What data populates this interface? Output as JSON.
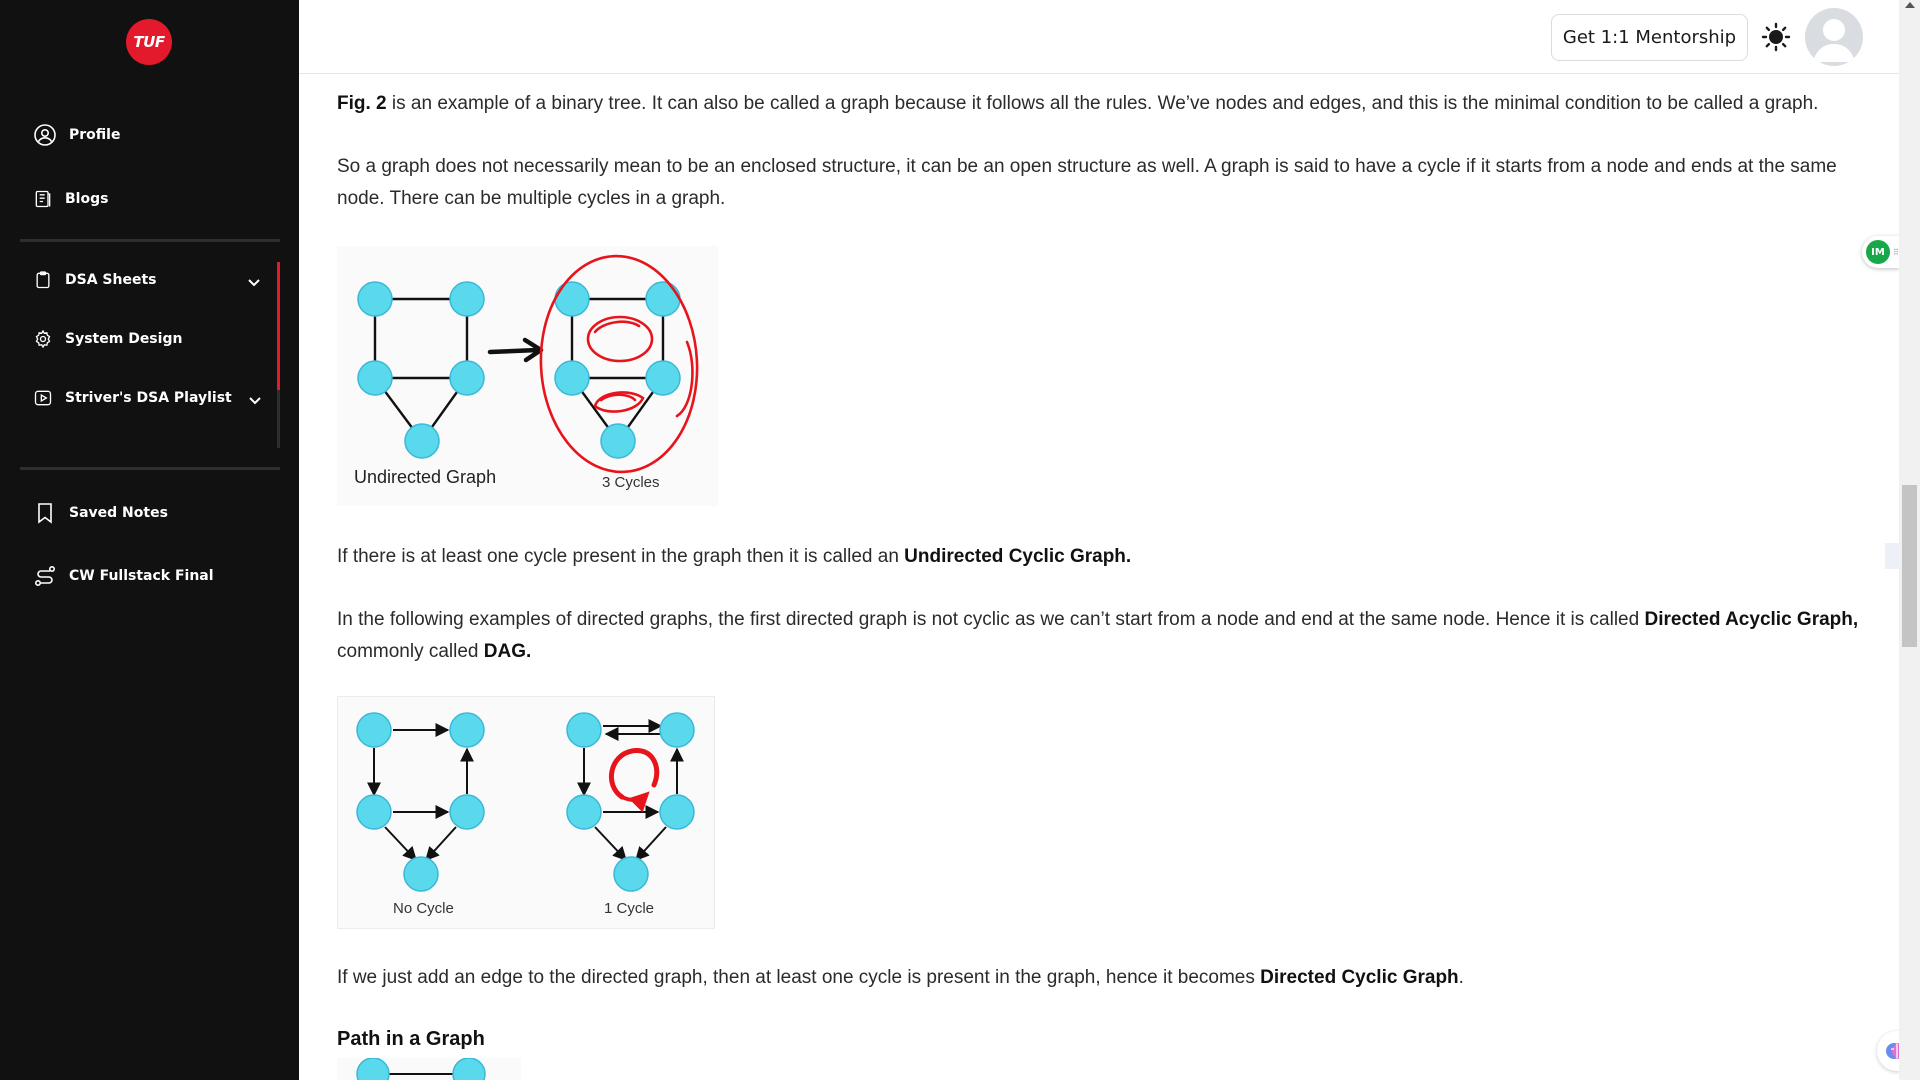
{
  "sidebar": {
    "logo_text": "TUF",
    "items": [
      {
        "label": "Profile"
      },
      {
        "label": "Blogs"
      },
      {
        "label": "DSA Sheets"
      },
      {
        "label": "System Design"
      },
      {
        "label": "Striver's DSA Playlist"
      },
      {
        "label": "Saved Notes"
      },
      {
        "label": "CW Fullstack Final"
      }
    ]
  },
  "header": {
    "mentorship_label": "Get 1:1 Mentorship"
  },
  "article": {
    "p1_bold": "Fig. 2",
    "p1_rest": " is an example of a binary tree. It can also be called a graph because it follows all the rules. We’ve nodes and edges, and this is the minimal condition to be called a graph.",
    "p2": "So a graph does not necessarily mean to be an enclosed structure, it can be an open structure as well. A graph is said to have a cycle if it starts from a node and ends at the same node. There can be multiple cycles in a graph.",
    "fig1_caption_left": "Undirected Graph",
    "fig1_caption_right": "3 Cycles",
    "p3_text": "If there is at least one cycle present in the graph then it is called an ",
    "p3_bold": "Undirected Cyclic Graph.",
    "p4_text": "In the following examples of directed graphs, the first directed graph is not cyclic as we can’t start from a node and end at the same node. Hence it is called ",
    "p4_bold1": "Directed Acyclic Graph,",
    "p4_mid": " commonly called ",
    "p4_bold2": "DAG.",
    "fig2_caption_left": "No Cycle",
    "fig2_caption_right": "1 Cycle",
    "p5_text": "If we just add an edge to the directed graph, then at least one cycle is present in the graph, hence it becomes ",
    "p5_bold": "Directed Cyclic Graph",
    "p5_end": ".",
    "heading": "Path in a Graph"
  },
  "extension": {
    "badge_text": "IM"
  },
  "colors": {
    "sidebar_bg": "#111111",
    "brand_red": "#e21a2c",
    "node_fill": "#5ad8ec",
    "node_stroke": "#3ab8d8",
    "cycle_red": "#e8141c"
  },
  "icons": [
    "user-circle-icon",
    "blog-icon",
    "clipboard-icon",
    "gear-icon",
    "play-icon",
    "bookmark-icon",
    "route-icon",
    "chevron-down-icon",
    "sun-icon",
    "brain-icon"
  ]
}
